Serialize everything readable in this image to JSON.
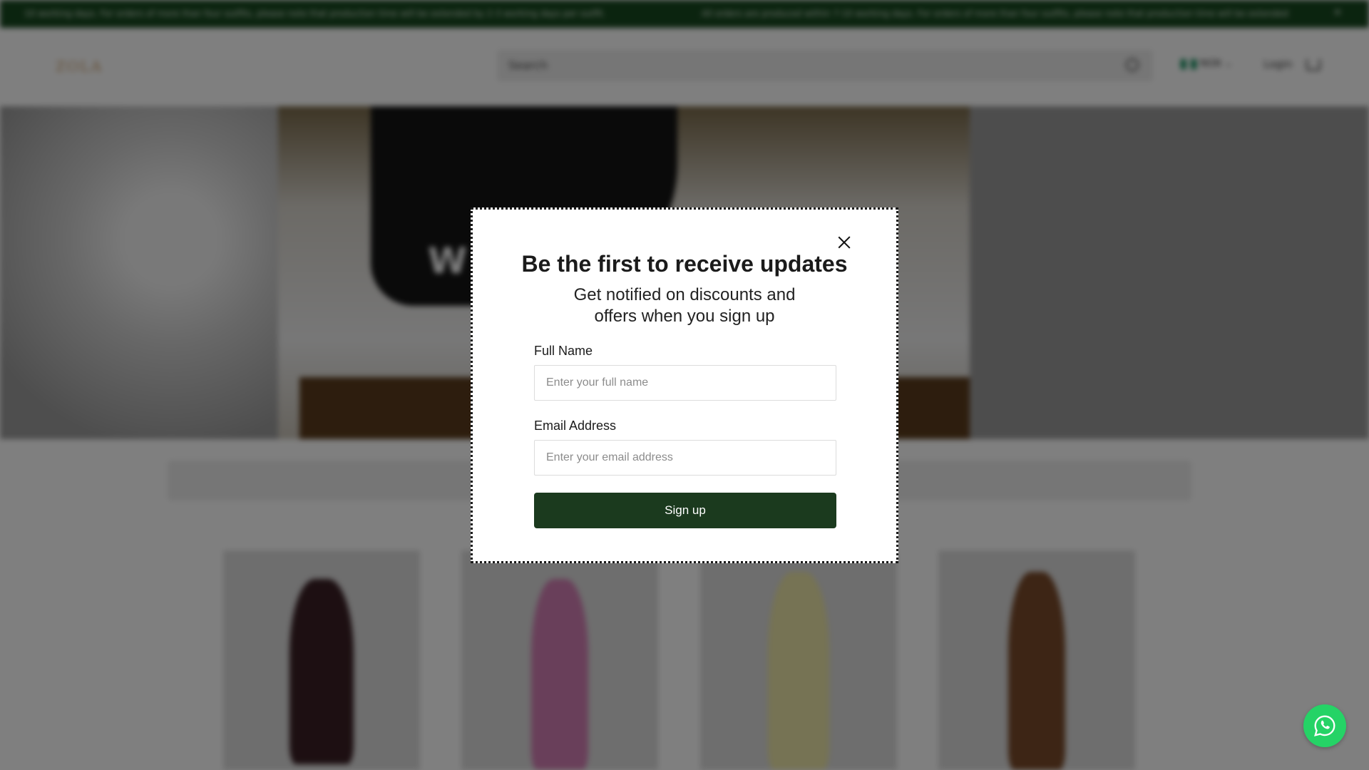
{
  "announcement": {
    "message_1": "10 working days. For orders of more than four outfits, please note that production time will be extended by 2-3 working days per outfit.",
    "message_2": "All orders are produced within 7-10 working days. For orders of more than four outfits, please note that production time will be extended",
    "close_glyph": "✕"
  },
  "header": {
    "logo": "ZOLA",
    "search_placeholder": "Search",
    "currency": "NGN",
    "login": "Login"
  },
  "hero": {
    "text": "W"
  },
  "modal": {
    "title": "Be the first to receive updates",
    "subtitle": "Get notified on discounts and offers when you sign up",
    "full_name_label": "Full Name",
    "full_name_placeholder": "Enter your full name",
    "email_label": "Email Address",
    "email_placeholder": "Enter your email address",
    "submit_label": "Sign up"
  },
  "products": [
    {
      "color": "#3a1f24"
    },
    {
      "color": "#d37fb4"
    },
    {
      "color": "#ece6a8"
    },
    {
      "color": "#7a4a2a"
    }
  ],
  "colors": {
    "announcement_bg": "#17481f",
    "button_bg": "#1b3a1e",
    "whatsapp": "#25d366"
  },
  "icons": {
    "close": "close-icon",
    "search": "search-icon",
    "cart": "cart-icon",
    "whatsapp": "whatsapp-icon"
  }
}
